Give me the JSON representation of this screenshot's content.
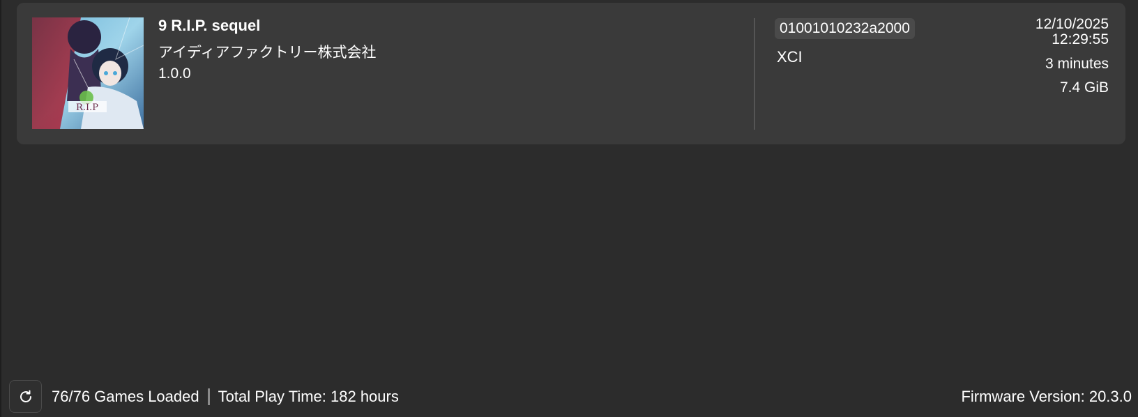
{
  "game": {
    "title": "9 R.I.P. sequel",
    "publisher": "アイディアファクトリー株式会社",
    "version": "1.0.0",
    "title_id": "01001010232a2000",
    "format": "XCI",
    "last_played_date": "12/10/2025",
    "last_played_time": "12:29:55",
    "play_time": "3 minutes",
    "size": "7.4 GiB",
    "cover_icon": "game-cover-art"
  },
  "statusbar": {
    "refresh_icon": "refresh-icon",
    "games_loaded": "76/76 Games Loaded",
    "total_play_time": "Total Play Time: 182 hours",
    "firmware": "Firmware Version: 20.3.0"
  },
  "colors": {
    "background": "#2c2c2c",
    "row_background": "#3a3a3a",
    "badge_background": "#4a4a4a",
    "text": "#ffffff"
  }
}
